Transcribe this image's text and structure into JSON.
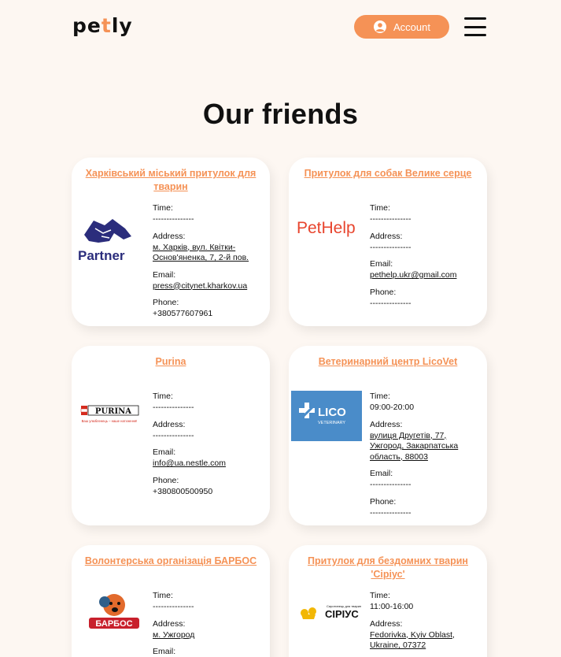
{
  "header": {
    "logo_left": "pe",
    "logo_accent": "t",
    "logo_right": "ly",
    "account_label": "Account",
    "account_icon": "user-circle-icon",
    "menu_icon": "hamburger-menu-icon",
    "accent_color": "#F59256"
  },
  "page": {
    "title": "Our friends"
  },
  "labels": {
    "time": "Time:",
    "address": "Address:",
    "email": "Email:",
    "phone": "Phone:"
  },
  "cards": [
    {
      "title": "Харківський міський притулок для тварин",
      "logo_text": "Partner",
      "time": "---------------",
      "address": "м. Харків, вул. Квітки-Основ'яненка, 7, 2-й пов.",
      "email": "press@citynet.kharkov.ua",
      "phone": "+380577607961"
    },
    {
      "title": "Притулок для собак Велике серце",
      "logo_text": "PetHelp",
      "time": "---------------",
      "address": "---------------",
      "email": "pethelp.ukr@gmail.com",
      "phone": "---------------"
    },
    {
      "title": "Purina",
      "logo_text": "PURINA",
      "logo_tagline": "Ваш улюбленець – наше натхнення!",
      "time": "---------------",
      "address": "---------------",
      "email": "info@ua.nestle.com",
      "phone": "+380800500950"
    },
    {
      "title": "Ветеринарний центр LicoVet",
      "logo_text": "LICO",
      "logo_subtext": "VETERINARY",
      "time": "09:00-20:00",
      "address": "вулиця Другетів, 77, Ужгород, Закарпатська область, 88003",
      "email": "---------------",
      "phone": "---------------"
    },
    {
      "title": "Волонтерська організація БАРБОС",
      "logo_text": "БАРБОС",
      "time": "---------------",
      "address": "м. Ужгород",
      "email": "---------------"
    },
    {
      "title": "Притулок для бездомних тварин 'Сіріус'",
      "logo_text": "СІРІУС",
      "logo_subtext": "Сиротинець для тварин",
      "time": "11:00-16:00",
      "address": "Fedorivka, Kyiv Oblast, Ukraine, 07372"
    }
  ]
}
